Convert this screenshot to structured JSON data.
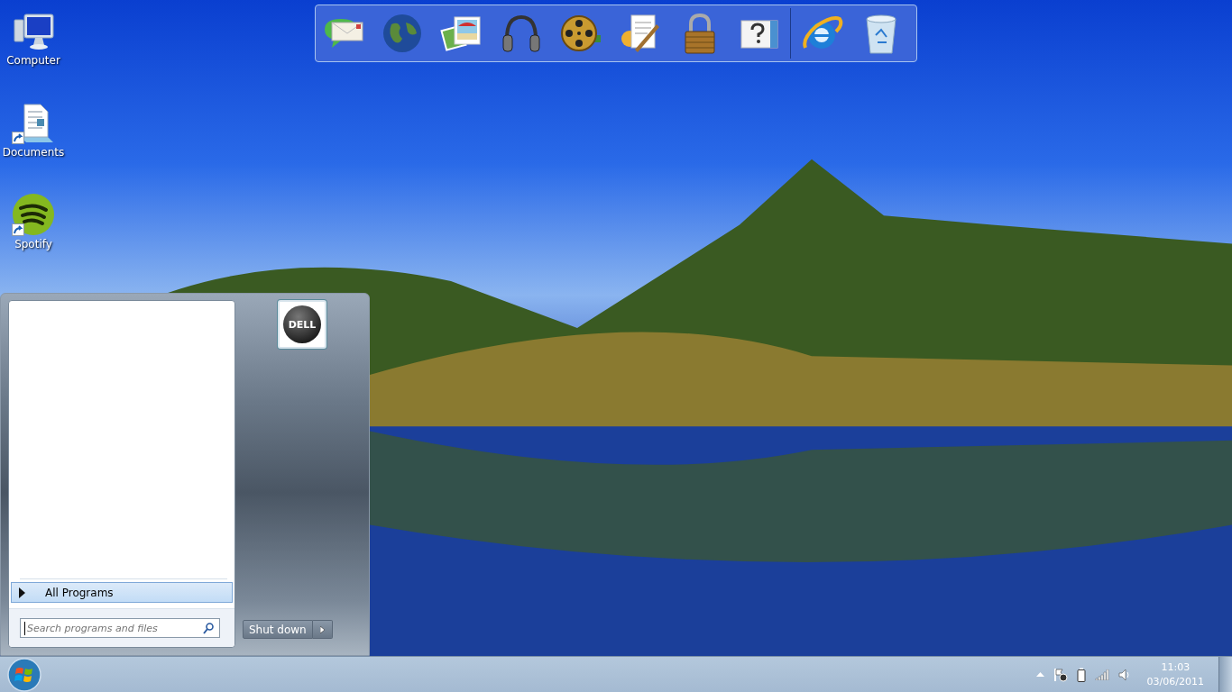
{
  "desktop_icons": [
    {
      "kind": "computer",
      "label": "Computer",
      "shortcut": false
    },
    {
      "kind": "document",
      "label": "Documents",
      "shortcut": true
    },
    {
      "kind": "spotify",
      "label": "Spotify",
      "shortcut": true
    }
  ],
  "dock": {
    "groups": [
      [
        {
          "kind": "mail"
        },
        {
          "kind": "globe"
        },
        {
          "kind": "photos"
        },
        {
          "kind": "headphones"
        },
        {
          "kind": "film"
        },
        {
          "kind": "document-pen"
        },
        {
          "kind": "padlock"
        },
        {
          "kind": "help"
        }
      ],
      [
        {
          "kind": "browser"
        },
        {
          "kind": "recycle-bin"
        }
      ]
    ]
  },
  "start_menu": {
    "all_programs": {
      "label": "All Programs",
      "selected": true
    },
    "search": {
      "placeholder": "Search programs and files"
    },
    "user_tile": {
      "logo_text": "DELL"
    },
    "shut_down": {
      "label": "Shut down"
    }
  },
  "taskbar": {
    "tray": [
      {
        "kind": "show-hidden"
      },
      {
        "kind": "action-center"
      },
      {
        "kind": "battery"
      },
      {
        "kind": "signal"
      },
      {
        "kind": "volume"
      }
    ],
    "time": "11:03",
    "date": "03/06/2011"
  }
}
